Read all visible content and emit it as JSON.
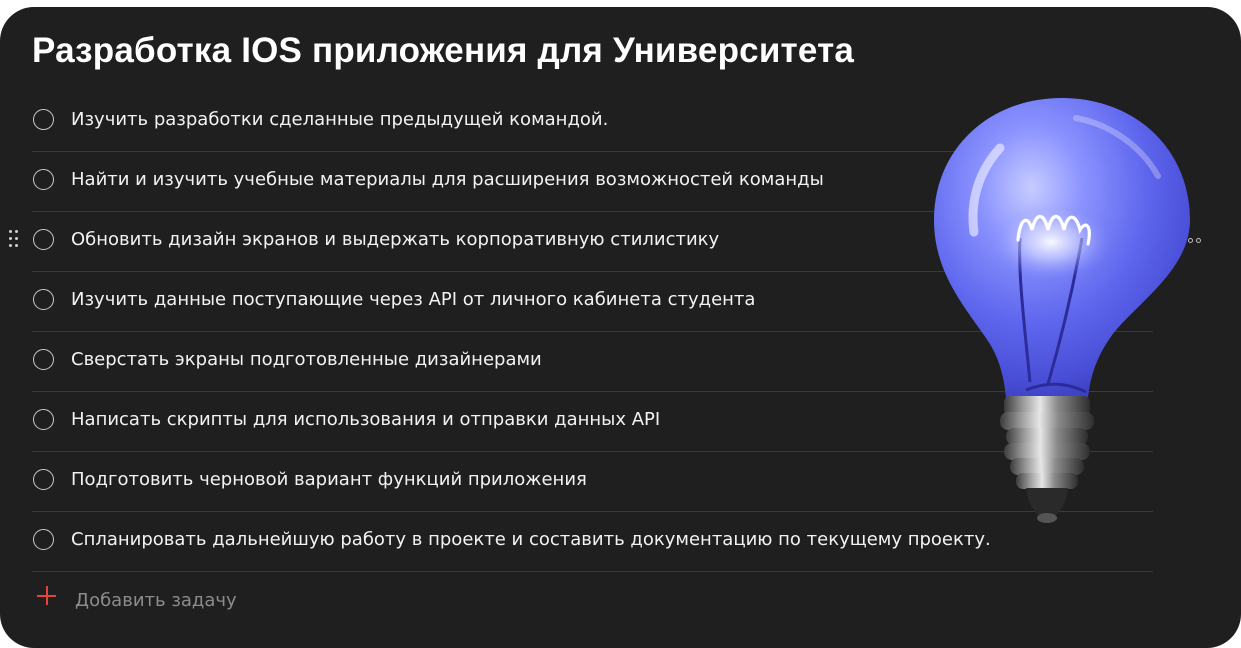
{
  "project": {
    "title": "Разработка IOS приложения для Университета"
  },
  "tasks": [
    {
      "label": "Изучить разработки сделанные предыдущей командой.",
      "completed": false
    },
    {
      "label": "Найти и изучить учебные материалы для расширения возможностей команды",
      "completed": false
    },
    {
      "label": "Обновить дизайн экранов и выдержать корпоративную стилистику",
      "completed": false
    },
    {
      "label": "Изучить данные поступающие через API от личного кабинета студента",
      "completed": false
    },
    {
      "label": "Сверстать экраны подготовленные дизайнерами",
      "completed": false
    },
    {
      "label": "Написать скрипты для использования и отправки данных API",
      "completed": false
    },
    {
      "label": "Подготовить черновой вариант функций приложения",
      "completed": false
    },
    {
      "label": "Спланировать дальнейшую работу в проекте и составить документацию по текущему проекту.",
      "completed": false
    }
  ],
  "add_task": {
    "label": "Добавить задачу"
  },
  "icons": {
    "checkbox": "circle-checkbox-icon",
    "drag": "drag-handle-icon",
    "more": "more-options-icon",
    "add": "plus-icon",
    "illustration": "lightbulb-illustration"
  },
  "colors": {
    "background": "#1f1f1f",
    "text": "#f2f2f2",
    "accent_add": "#e2453b",
    "divider": "#3a3a3a",
    "bulb_glass": "#6a74f2"
  }
}
